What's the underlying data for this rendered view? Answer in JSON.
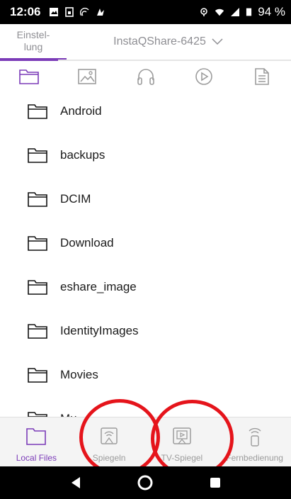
{
  "status_bar": {
    "time": "12:06",
    "battery": "94 %"
  },
  "header": {
    "settings_label": "Einstel-\nlung",
    "device_name": "InstaQShare-6425"
  },
  "category_tabs": [
    {
      "icon": "folder-icon",
      "active": true
    },
    {
      "icon": "image-icon",
      "active": false
    },
    {
      "icon": "headphones-icon",
      "active": false
    },
    {
      "icon": "play-icon",
      "active": false
    },
    {
      "icon": "document-icon",
      "active": false
    }
  ],
  "files": [
    {
      "name": "Android"
    },
    {
      "name": "backups"
    },
    {
      "name": "DCIM"
    },
    {
      "name": "Download"
    },
    {
      "name": "eshare_image"
    },
    {
      "name": "IdentityImages"
    },
    {
      "name": "Movies"
    },
    {
      "name": "Mu"
    }
  ],
  "bottom_nav": {
    "local_files": "Local Files",
    "mirror": "Spiegeln",
    "tv_mirror": "TV-Spiegel",
    "remote": "Fernbedienung"
  },
  "colors": {
    "accent": "#7b3bb8",
    "annotation": "#e5141b"
  }
}
